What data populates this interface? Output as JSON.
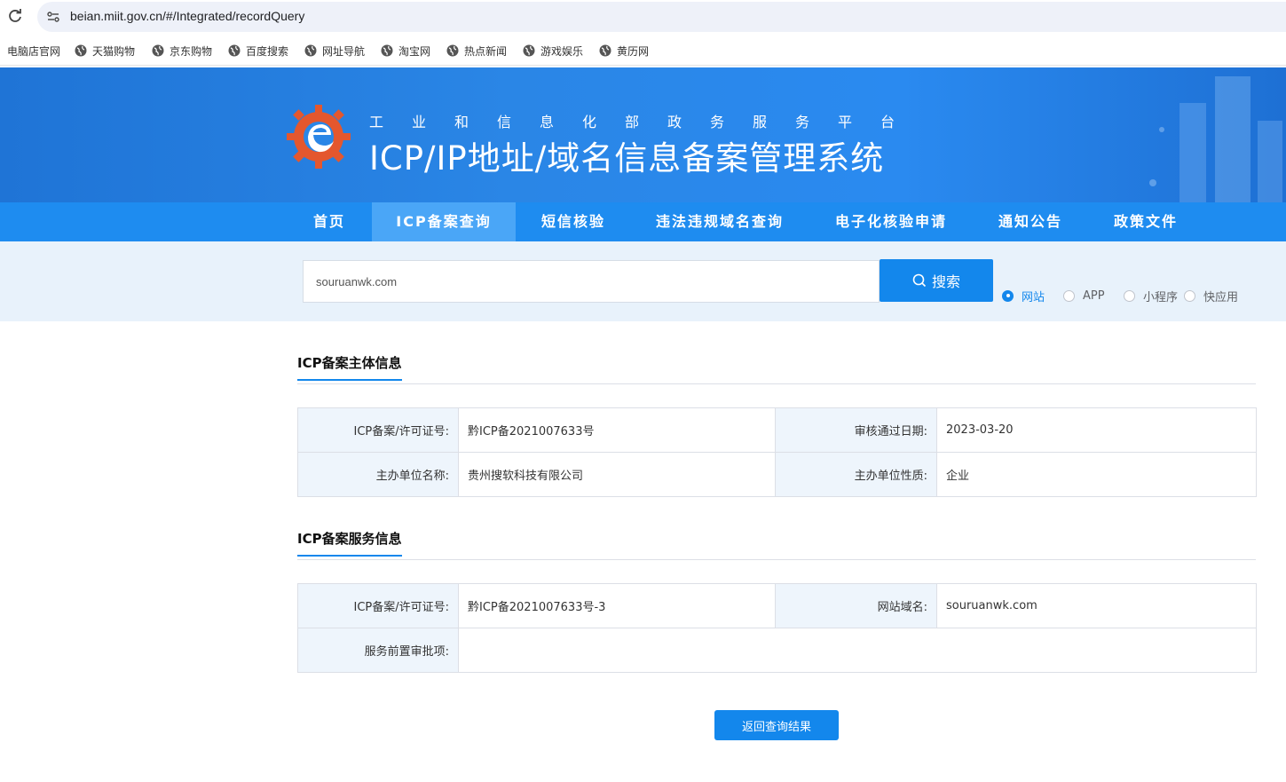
{
  "browser": {
    "url": "beian.miit.gov.cn/#/Integrated/recordQuery",
    "bookmarks": [
      "电脑店官网",
      "天猫购物",
      "京东购物",
      "百度搜索",
      "网址导航",
      "淘宝网",
      "热点新闻",
      "游戏娱乐",
      "黄历网"
    ]
  },
  "header": {
    "subtitle": "工业和信息化部政务服务平台",
    "title": "ICP/IP地址/域名信息备案管理系统"
  },
  "nav": {
    "items": [
      "首页",
      "ICP备案查询",
      "短信核验",
      "违法违规域名查询",
      "电子化核验申请",
      "通知公告",
      "政策文件"
    ],
    "active": "ICP备案查询"
  },
  "search": {
    "value": "souruanwk.com",
    "button_label": "搜索",
    "types": [
      "网站",
      "APP",
      "小程序",
      "快应用"
    ],
    "selected_type": "网站"
  },
  "subject": {
    "title": "ICP备案主体信息",
    "license_key": "ICP备案/许可证号:",
    "license_value": "黔ICP备2021007633号",
    "date_key": "审核通过日期:",
    "date_value": "2023-03-20",
    "org_key": "主办单位名称:",
    "org_value": "贵州搜软科技有限公司",
    "nature_key": "主办单位性质:",
    "nature_value": "企业"
  },
  "service": {
    "title": "ICP备案服务信息",
    "license_key": "ICP备案/许可证号:",
    "license_value": "黔ICP备2021007633号-3",
    "domain_key": "网站域名:",
    "domain_value": "souruanwk.com",
    "approval_key": "服务前置审批项:",
    "approval_value": ""
  },
  "back_button": "返回查询结果",
  "colors": {
    "primary": "#1387ec",
    "nav": "#1e8cf0",
    "banner": "#2a86e6"
  }
}
